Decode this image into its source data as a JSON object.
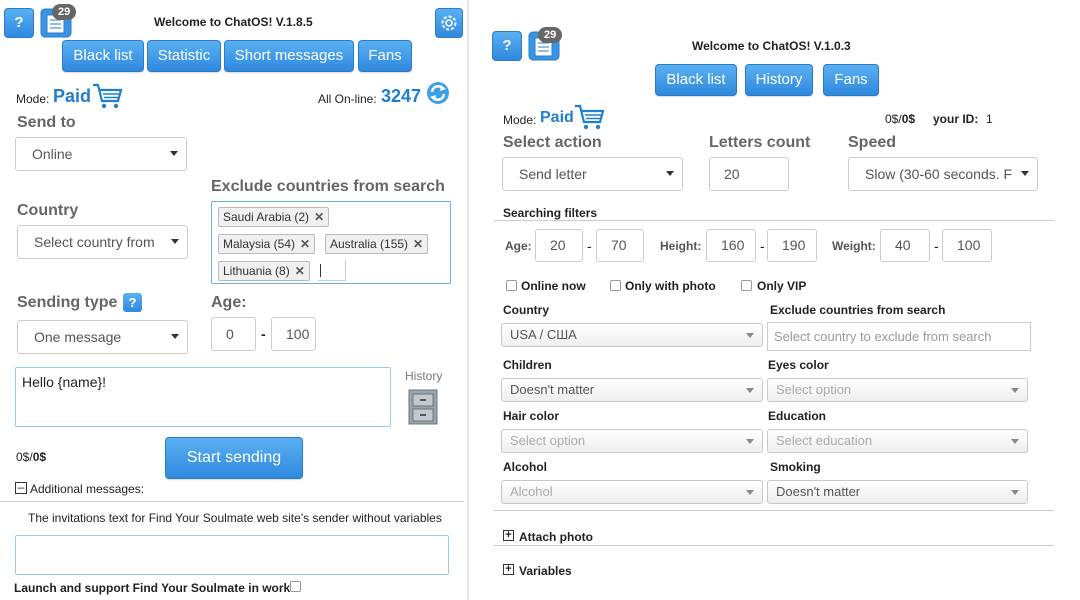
{
  "left": {
    "title": "Welcome to ChatOS! V.1.8.5",
    "help_label": "?",
    "messages_badge": "29",
    "nav": [
      "Black list",
      "Statistic",
      "Short messages",
      "Fans"
    ],
    "mode_label": "Mode:",
    "mode_value": "Paid",
    "online_label": "All On-line:",
    "online_count": "3247",
    "send_to_label": "Send to",
    "send_to_value": "Online",
    "exclude_label": "Exclude countries from search",
    "excluded_countries": [
      "Saudi Arabia (2)",
      "Malaysia (54)",
      "Australia (155)",
      "Lithuania (8)"
    ],
    "country_label": "Country",
    "country_placeholder": "Select country from",
    "sending_type_label": "Sending type",
    "sending_type_help": "?",
    "sending_type_value": "One message",
    "age_label": "Age:",
    "age_from": "0",
    "age_to": "100",
    "age_sep": "-",
    "message_text": "Hello {name}!",
    "history_label": "History",
    "balance_prefix": "0$/",
    "balance_bold": "0$",
    "start_button": "Start sending",
    "additional_label": "Additional messages:",
    "invitations_text": "The invitations text for Find Your Soulmate web site's sender without variables",
    "launch_label": "Launch and support Find Your Soulmate in work"
  },
  "right": {
    "title": "Welcome to ChatOS! V.1.0.3",
    "help_label": "?",
    "messages_badge": "29",
    "nav": [
      "Black list",
      "History",
      "Fans"
    ],
    "mode_label": "Mode:",
    "mode_value": "Paid",
    "balance_prefix": "0$/",
    "balance_bold": "0$",
    "your_id_label": "your ID:",
    "your_id_value": "1",
    "select_action_label": "Select action",
    "select_action_value": "Send letter",
    "letters_count_label": "Letters count",
    "letters_count_value": "20",
    "speed_label": "Speed",
    "speed_value": "Slow (30-60 seconds. F",
    "filters_label": "Searching filters",
    "age_label": "Age:",
    "age_from": "20",
    "age_to": "70",
    "height_label": "Height:",
    "height_from": "160",
    "height_to": "190",
    "weight_label": "Weight:",
    "weight_from": "40",
    "weight_to": "100",
    "sep": "-",
    "checkboxes": [
      "Online now",
      "Only with photo",
      "Only VIP"
    ],
    "country_label": "Country",
    "country_value": "USA / США",
    "exclude_label": "Exclude countries from search",
    "exclude_placeholder": "Select country to exclude from search",
    "children_label": "Children",
    "children_value": "Doesn't matter",
    "eyes_label": "Eyes color",
    "eyes_value": "Select option",
    "hair_label": "Hair color",
    "hair_value": "Select option",
    "education_label": "Education",
    "education_value": "Select education",
    "alcohol_label": "Alcohol",
    "alcohol_value": "Alcohol",
    "smoking_label": "Smoking",
    "smoking_value": "Doesn't matter",
    "attach_label": "Attach photo",
    "variables_label": "Variables",
    "plus_sign": "+"
  },
  "colors": {
    "accent": "#2f89de",
    "link_blue": "#1e7fd1"
  }
}
